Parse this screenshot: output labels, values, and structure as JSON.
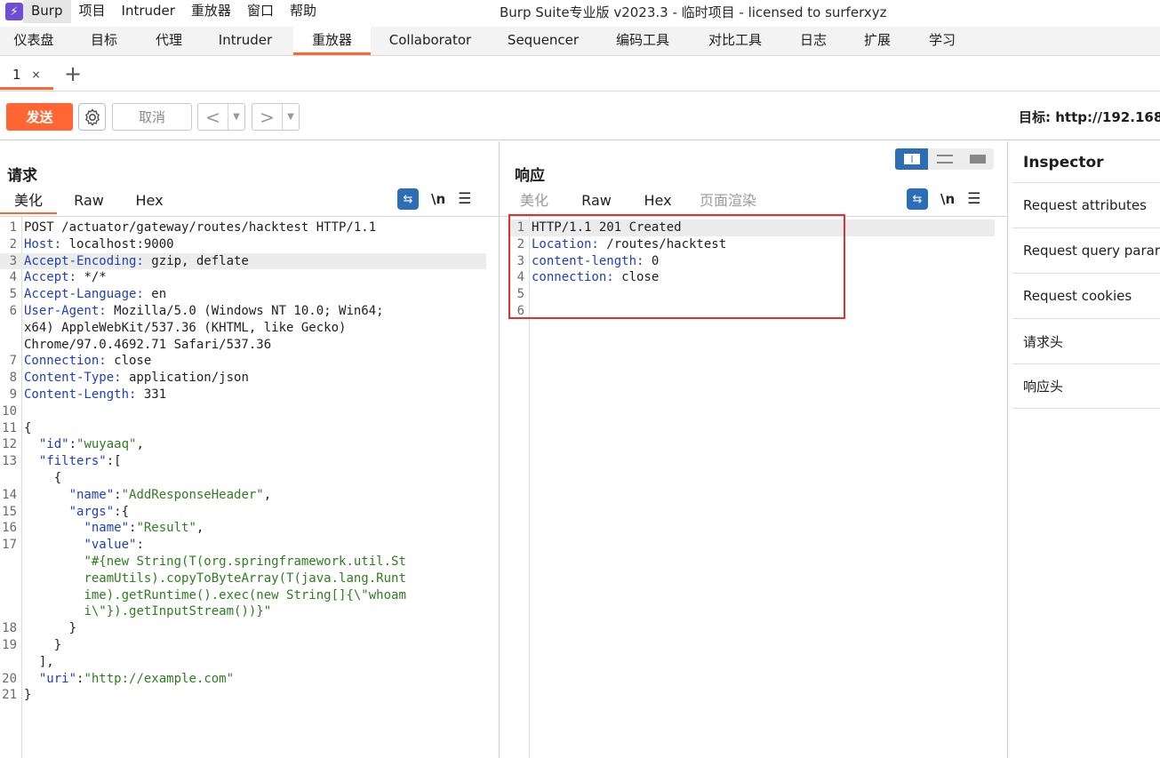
{
  "menubar": {
    "logo_glyph": "⚡",
    "items": [
      "Burp",
      "项目",
      "Intruder",
      "重放器",
      "窗口",
      "帮助"
    ],
    "window_title": "Burp Suite专业版  v2023.3 - 临时项目 - licensed to surferxyz"
  },
  "main_tabs": [
    "仪表盘",
    "目标",
    "代理",
    "Intruder",
    "重放器",
    "Collaborator",
    "Sequencer",
    "编码工具",
    "对比工具",
    "日志",
    "扩展",
    "学习"
  ],
  "sub_tabs": {
    "tab_label": "1",
    "close_glyph": "×",
    "add_glyph": "+"
  },
  "toolbar": {
    "send_label": "发送",
    "settings_icon": "gear-icon",
    "cancel_label": "取消",
    "back_glyph": "<",
    "forward_glyph": ">",
    "dropdown_glyph": "▼",
    "target_text": "目标: http://192.168"
  },
  "request": {
    "title": "请求",
    "tabs": [
      "美化",
      "Raw",
      "Hex"
    ],
    "tools": {
      "wrap_glyph": "⇆",
      "newline_label": "\\n",
      "menu_glyph": "☰"
    }
  },
  "response": {
    "title": "响应",
    "tabs": [
      "美化",
      "Raw",
      "Hex",
      "页面渲染"
    ],
    "tools": {
      "wrap_glyph": "⇆",
      "newline_label": "\\n",
      "menu_glyph": "☰"
    }
  },
  "inspector": {
    "title": "Inspector",
    "rows": [
      "Request attributes",
      "Request query parar",
      "Request cookies",
      "请求头",
      "响应头"
    ]
  },
  "colors": {
    "accent": "#ff6633",
    "blue": "#2d6db5",
    "highlight_box": "#e03131"
  }
}
